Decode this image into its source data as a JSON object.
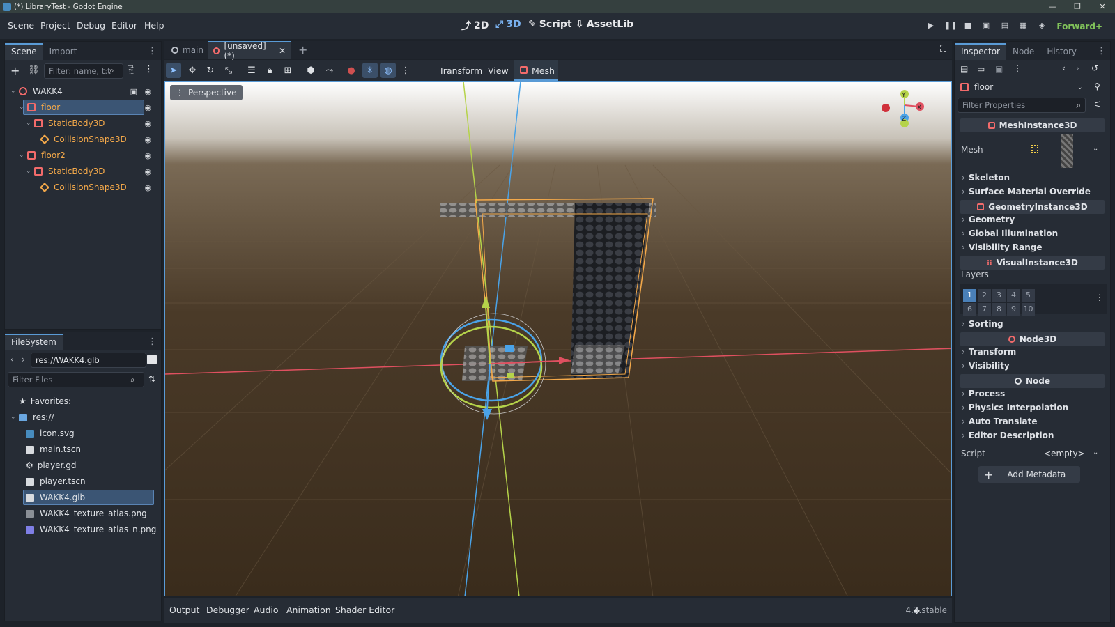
{
  "window": {
    "title": "(*) LibraryTest - Godot Engine",
    "controls": [
      "—",
      "❐",
      "✕"
    ]
  },
  "menu": {
    "items": [
      "Scene",
      "Project",
      "Debug",
      "Editor",
      "Help"
    ]
  },
  "workspaces": {
    "items": [
      "2D",
      "3D",
      "Script",
      "AssetLib"
    ],
    "active": "3D"
  },
  "run_controls": [
    "play",
    "pause",
    "stop",
    "remote-debug",
    "movie",
    "run-current",
    "run-custom"
  ],
  "renderer": "Forward+",
  "scene_dock": {
    "tabs": [
      "Scene",
      "Import"
    ],
    "filter_placeholder": "Filter: name, t:t",
    "tree": [
      {
        "label": "WAKK4",
        "depth": 0,
        "icon": "node3d-icon",
        "color": "#dde0e4"
      },
      {
        "label": "floor",
        "depth": 1,
        "icon": "meshinstance-icon",
        "color": "#f4a94a",
        "selected": true
      },
      {
        "label": "StaticBody3D",
        "depth": 2,
        "icon": "staticbody-icon",
        "color": "#f4a94a"
      },
      {
        "label": "CollisionShape3D",
        "depth": 3,
        "icon": "collisionshape-icon",
        "color": "#f4a94a"
      },
      {
        "label": "floor2",
        "depth": 1,
        "icon": "meshinstance-icon",
        "color": "#f4a94a"
      },
      {
        "label": "StaticBody3D",
        "depth": 2,
        "icon": "staticbody-icon",
        "color": "#f4a94a"
      },
      {
        "label": "CollisionShape3D",
        "depth": 3,
        "icon": "collisionshape-icon",
        "color": "#f4a94a"
      }
    ]
  },
  "filesystem": {
    "tab": "FileSystem",
    "path": "res://WAKK4.glb",
    "filter_placeholder": "Filter Files",
    "favorites": "Favorites:",
    "root": "res://",
    "files": [
      "icon.svg",
      "main.tscn",
      "player.gd",
      "player.tscn",
      "WAKK4.glb",
      "WAKK4_texture_atlas.png",
      "WAKK4_texture_atlas_n.png"
    ],
    "selected": "WAKK4.glb"
  },
  "editor_tabs": {
    "tabs": [
      "main",
      "[unsaved](*)"
    ],
    "active": "[unsaved](*)"
  },
  "viewport_toolbar": {
    "menus": [
      "Transform",
      "View",
      "Mesh"
    ],
    "perspective": "Perspective"
  },
  "bottom_panel": {
    "tabs": [
      "Output",
      "Debugger",
      "Audio",
      "Animation",
      "Shader Editor"
    ],
    "version": "4.3.stable"
  },
  "inspector": {
    "tabs": [
      "Inspector",
      "Node",
      "History"
    ],
    "object": "floor",
    "filter_placeholder": "Filter Properties",
    "class_mesh": "MeshInstance3D",
    "mesh_label": "Mesh",
    "sections_a": [
      "Skeleton",
      "Surface Material Override"
    ],
    "class_geometry": "GeometryInstance3D",
    "sections_b": [
      "Geometry",
      "Global Illumination",
      "Visibility Range"
    ],
    "class_visual": "VisualInstance3D",
    "layers_label": "Layers",
    "layers": [
      "1",
      "2",
      "3",
      "4",
      "5",
      "6",
      "7",
      "8",
      "9",
      "10"
    ],
    "sections_c": [
      "Sorting"
    ],
    "class_node3d": "Node3D",
    "sections_d": [
      "Transform",
      "Visibility"
    ],
    "class_node": "Node",
    "sections_e": [
      "Process",
      "Physics Interpolation",
      "Auto Translate",
      "Editor Description"
    ],
    "script_label": "Script",
    "script_value": "<empty>",
    "add_metadata": "Add Metadata"
  },
  "gizmo_labels": {
    "y": "Y",
    "x": "X",
    "z": "Z"
  },
  "colors": {
    "accent": "#5a9bd6",
    "node_orange": "#f4a94a",
    "renderer_green": "#81c35a"
  }
}
